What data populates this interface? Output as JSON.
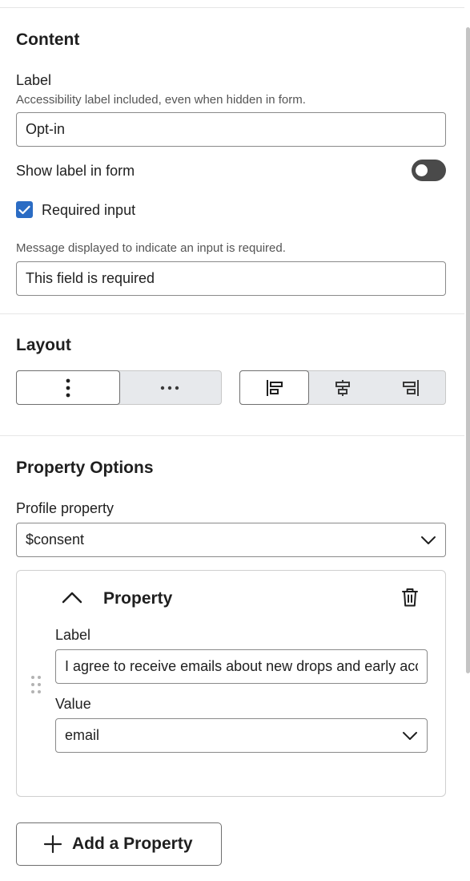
{
  "content": {
    "section_title": "Content",
    "label_title": "Label",
    "label_helper": "Accessibility label included, even when hidden in form.",
    "label_value": "Opt-in",
    "show_label_text": "Show label in form",
    "show_label_on": false,
    "required_text": "Required input",
    "required_checked": true,
    "required_message_helper": "Message displayed to indicate an input is required.",
    "required_message_value": "This field is required"
  },
  "layout": {
    "section_title": "Layout",
    "orientation_options": [
      "vertical",
      "horizontal"
    ],
    "orientation_selected": "vertical",
    "alignment_options": [
      "left",
      "center",
      "right"
    ],
    "alignment_selected": "left"
  },
  "property_options": {
    "section_title": "Property Options",
    "profile_property_label": "Profile property",
    "profile_property_value": "$consent",
    "property_card": {
      "title": "Property",
      "label_title": "Label",
      "label_value": "I agree to receive emails about new drops and early access",
      "value_title": "Value",
      "value_selected": "email"
    },
    "add_button_label": "Add a Property"
  },
  "colors": {
    "accent": "#2b6cc4",
    "toggle_off": "#4a4a4a"
  },
  "icons": {
    "drag": "drag-handle-icon",
    "delete": "trash-icon",
    "collapse": "chevron-up-icon",
    "dropdown": "chevron-down-icon",
    "add": "plus-icon",
    "check": "checkmark-icon"
  }
}
